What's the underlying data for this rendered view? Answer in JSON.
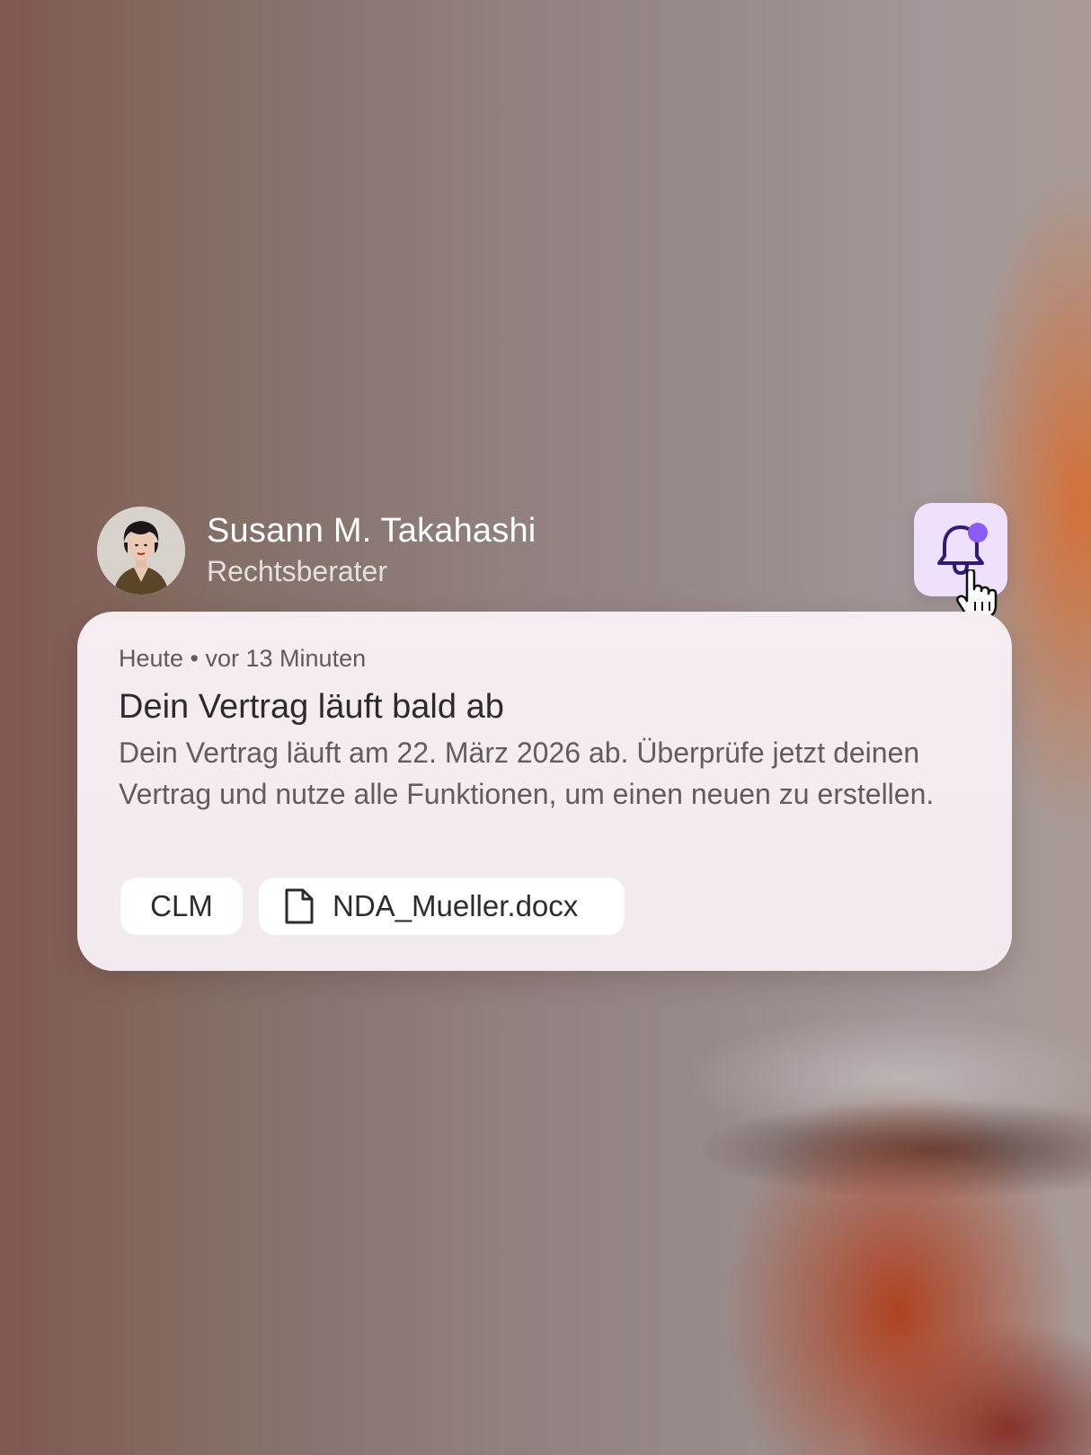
{
  "user": {
    "name": "Susann M. Takahashi",
    "role": "Rechtsberater"
  },
  "notification": {
    "meta": "Heute • vor 13 Minuten",
    "title": "Dein Vertrag läuft bald ab",
    "body": "Dein Vertrag läuft am 22. März 2026 ab. Überprüfe jetzt deinen Vertrag und nutze alle Funktionen, um einen neuen zu erstellen.",
    "tag": "CLM",
    "attachment": "NDA_Mueller.docx"
  },
  "icons": {
    "bell": "bell-icon",
    "unread_indicator": "notification-dot-icon",
    "file": "file-icon",
    "cursor": "hand-cursor-icon"
  },
  "colors": {
    "bell_button_bg": "#efe0fb",
    "bell_stroke": "#2f1a7a",
    "unread_dot": "#8b5cf6",
    "card_bg": "#f4ecf0"
  }
}
